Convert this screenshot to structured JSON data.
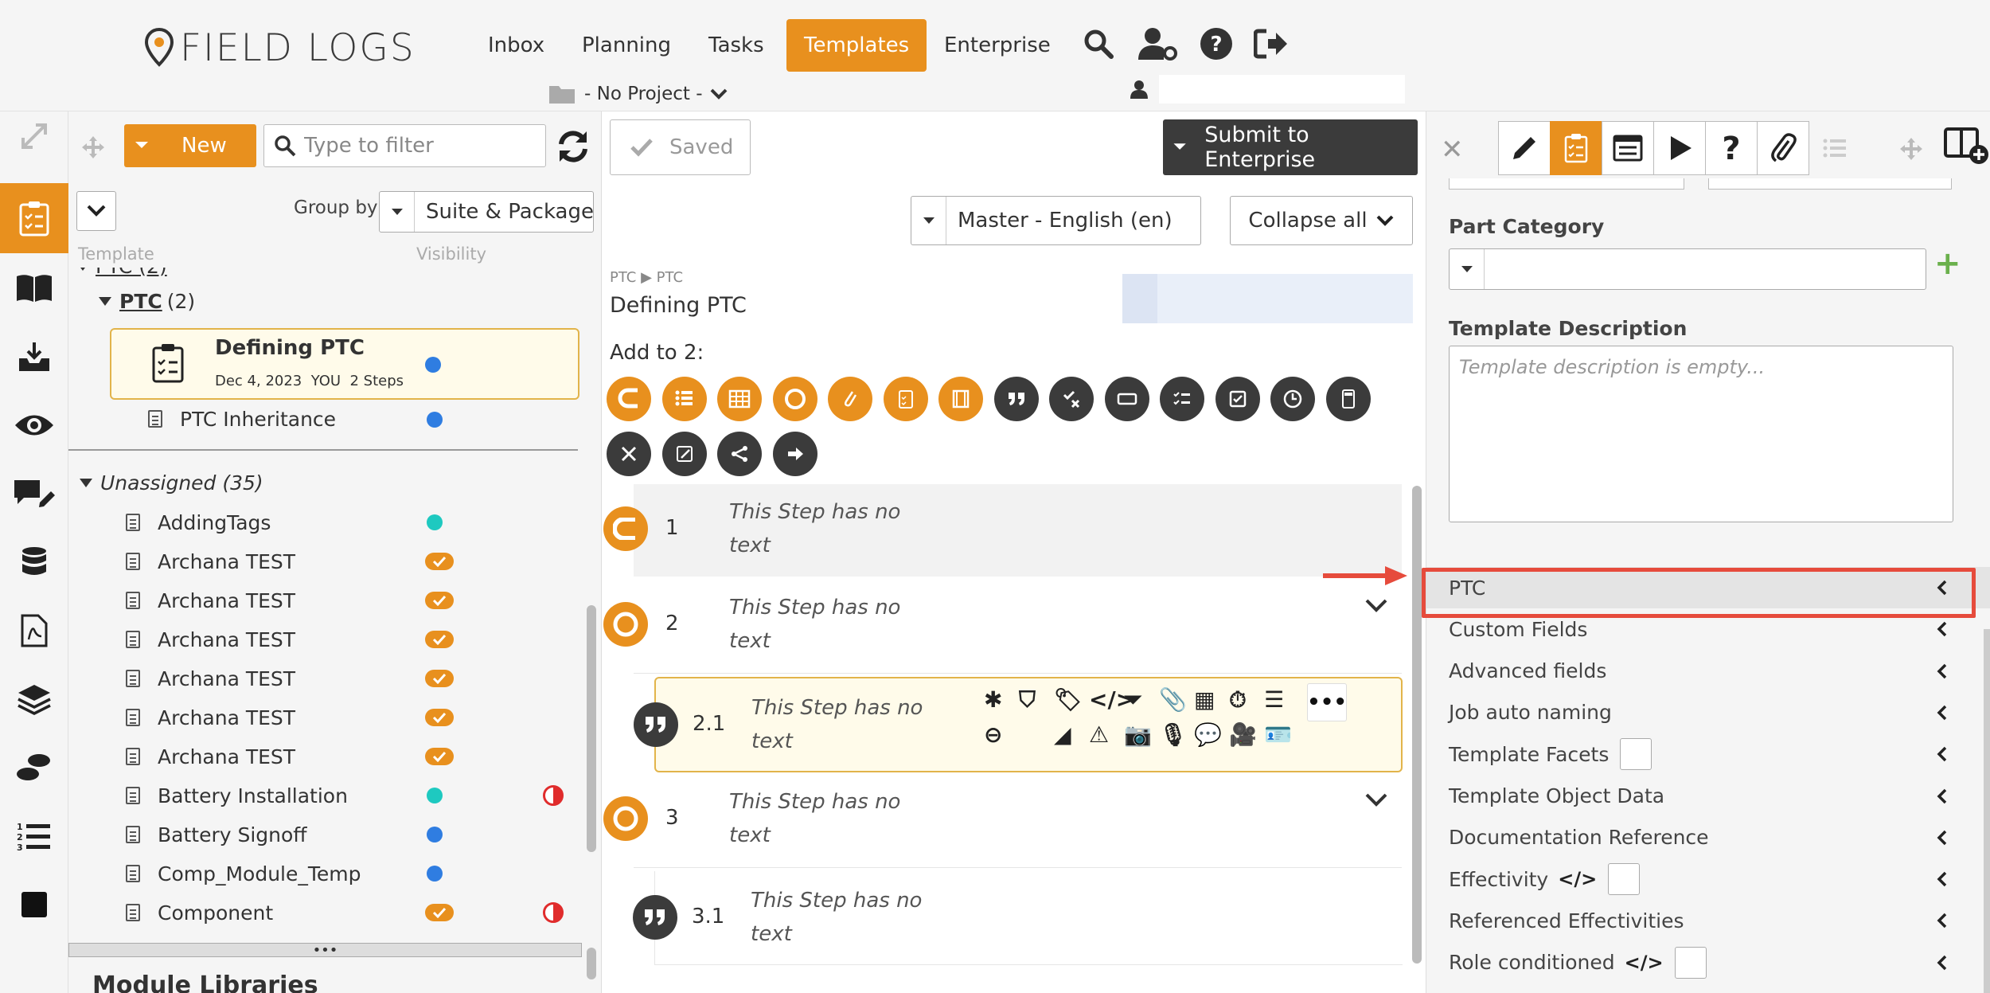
{
  "brand": {
    "name": "FIELD LOGS",
    "accent": "#e8901e",
    "dark": "#3b3b3b",
    "highlight": "#e64b3c"
  },
  "nav": {
    "items": [
      "Inbox",
      "Planning",
      "Tasks",
      "Templates",
      "Enterprise"
    ],
    "active": "Templates",
    "icons": [
      "search-icon",
      "user-settings-icon",
      "help-icon",
      "logout-icon"
    ]
  },
  "project": {
    "label": "- No Project -"
  },
  "left_toolbar": {
    "new_label": "New",
    "filter_placeholder": "Type to filter"
  },
  "group_by": {
    "label": "Group by",
    "value": "Suite & Package"
  },
  "columns": {
    "template": "Template",
    "visibility": "Visibility"
  },
  "tree": {
    "parent_label": "PTC (2)",
    "folder_name": "PTC",
    "folder_count": "(2)",
    "selected": {
      "title": "Defining PTC",
      "meta": "Dec 4, 2023  YOU  2 Steps"
    },
    "sibling": "PTC Inheritance",
    "unassigned_label": "Unassigned (35)",
    "items": [
      {
        "name": "AddingTags",
        "status": "teal"
      },
      {
        "name": "Archana TEST",
        "status": "check"
      },
      {
        "name": "Archana TEST",
        "status": "check"
      },
      {
        "name": "Archana TEST",
        "status": "check"
      },
      {
        "name": "Archana TEST",
        "status": "check"
      },
      {
        "name": "Archana TEST",
        "status": "check"
      },
      {
        "name": "Archana TEST",
        "status": "check"
      },
      {
        "name": "Battery Installation",
        "status": "teal",
        "flag": true
      },
      {
        "name": "Battery Signoff",
        "status": "blue"
      },
      {
        "name": "Comp_Module_Temp",
        "status": "blue"
      },
      {
        "name": "Component",
        "status": "check",
        "flag": true
      }
    ],
    "scroll_label": "•••",
    "module_libraries": "Module Libraries"
  },
  "center": {
    "saved_label": "Saved",
    "submit_label": "Submit to Enterprise",
    "language": "Master - English (en)",
    "collapse_label": "Collapse all",
    "breadcrumb": "PTC ▶ PTC",
    "doc_title": "Defining PTC",
    "add_to_label": "Add to 2:",
    "steps": [
      {
        "num": "1",
        "text": "This Step has no text",
        "kind": "start"
      },
      {
        "num": "2",
        "text": "This Step has no text",
        "kind": "circle"
      },
      {
        "num": "2.1",
        "text": "This Step has no text",
        "kind": "quote"
      },
      {
        "num": "3",
        "text": "This Step has no text",
        "kind": "circle"
      },
      {
        "num": "3.1",
        "text": "This Step has no text",
        "kind": "quote"
      }
    ]
  },
  "right": {
    "part_category_label": "Part Category",
    "description_label": "Template Description",
    "description_placeholder": "Template description is empty...",
    "sections": [
      {
        "label": "PTC",
        "highlighted": true
      },
      {
        "label": "Custom Fields"
      },
      {
        "label": "Advanced fields"
      },
      {
        "label": "Job auto naming"
      },
      {
        "label": "Template Facets",
        "checkbox": true
      },
      {
        "label": "Template Object Data"
      },
      {
        "label": "Documentation Reference"
      },
      {
        "label": "Effectivity",
        "code": true,
        "checkbox": true
      },
      {
        "label": "Referenced Effectivities"
      },
      {
        "label": "Role conditioned",
        "code": true,
        "checkbox": true
      }
    ]
  }
}
